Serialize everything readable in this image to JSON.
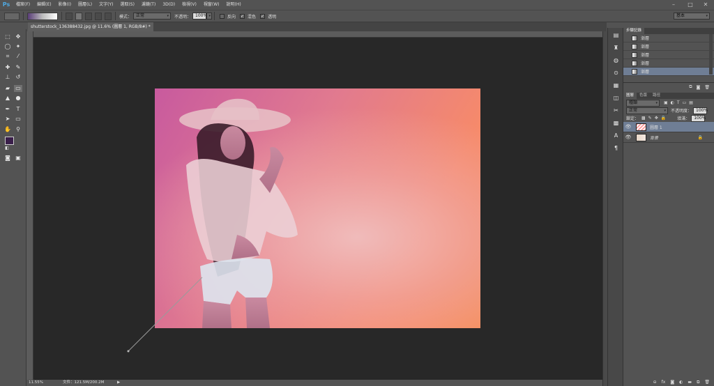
{
  "app": {
    "logo": "Ps"
  },
  "menu": [
    "檔案(F)",
    "編輯(E)",
    "影像(I)",
    "圖層(L)",
    "文字(Y)",
    "選取(S)",
    "濾鏡(T)",
    "3D(D)",
    "檢視(V)",
    "視窗(W)",
    "說明(H)"
  ],
  "window_controls": {
    "minimize": "–",
    "maximize": "□",
    "close": "✕"
  },
  "options": {
    "mode_label": "模式：",
    "mode_value": "正常",
    "opacity_label": "不透明：",
    "opacity_value": "100%",
    "reverse_label": "反向",
    "dither_label": "混色",
    "transparency_label": "透明",
    "workspace_value": "基本"
  },
  "document": {
    "tab_title": "shutterstock_136388432.jpg @ 11.6% (圖層 1, RGB/8#) *",
    "tab_close": "×",
    "zoom": "11.55%",
    "file_info": "文件：121.5M/200.2M"
  },
  "colors": {
    "foreground": "#3a1f4a",
    "background": "#000000",
    "ps_blue": "#4fa8e0",
    "selection": "#6f7e95"
  },
  "history_panel": {
    "tab": "步驟記錄",
    "items": [
      "漸層",
      "漸層",
      "漸層",
      "漸層",
      "漸層"
    ]
  },
  "layers_panel": {
    "tabs": [
      "圖層",
      "色版",
      "路徑"
    ],
    "filter_label": "種類",
    "blend_mode": "正常",
    "opacity_label": "不透明度：",
    "opacity_value": "100%",
    "lock_label": "鎖定：",
    "fill_label": "填滿：",
    "fill_value": "100%",
    "layers": [
      {
        "name": "圖層 1",
        "selected": true
      },
      {
        "name": "背景",
        "selected": false
      }
    ]
  }
}
